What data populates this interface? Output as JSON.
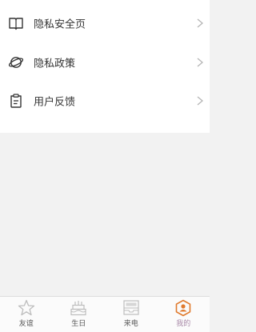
{
  "menu": {
    "items": [
      {
        "label": "隐私安全页",
        "icon": "open-book-icon"
      },
      {
        "label": "隐私政策",
        "icon": "planet-icon"
      },
      {
        "label": "用户反馈",
        "icon": "clipboard-icon"
      }
    ]
  },
  "tabbar": {
    "tabs": [
      {
        "label": "友谊",
        "icon": "star-icon",
        "active": false
      },
      {
        "label": "生日",
        "icon": "birthday-cake-icon",
        "active": false
      },
      {
        "label": "来电",
        "icon": "inbox-icon",
        "active": false
      },
      {
        "label": "我的",
        "icon": "profile-hexagon-icon",
        "active": true
      }
    ]
  },
  "colors": {
    "background": "#f2f2f2",
    "menu_background": "#ffffff",
    "text": "#333333",
    "tab_text": "#555555",
    "active_tab_text": "#a98aa8",
    "active_tab_icon": "#e07a2e",
    "icon_gray": "#bdbdbd"
  }
}
